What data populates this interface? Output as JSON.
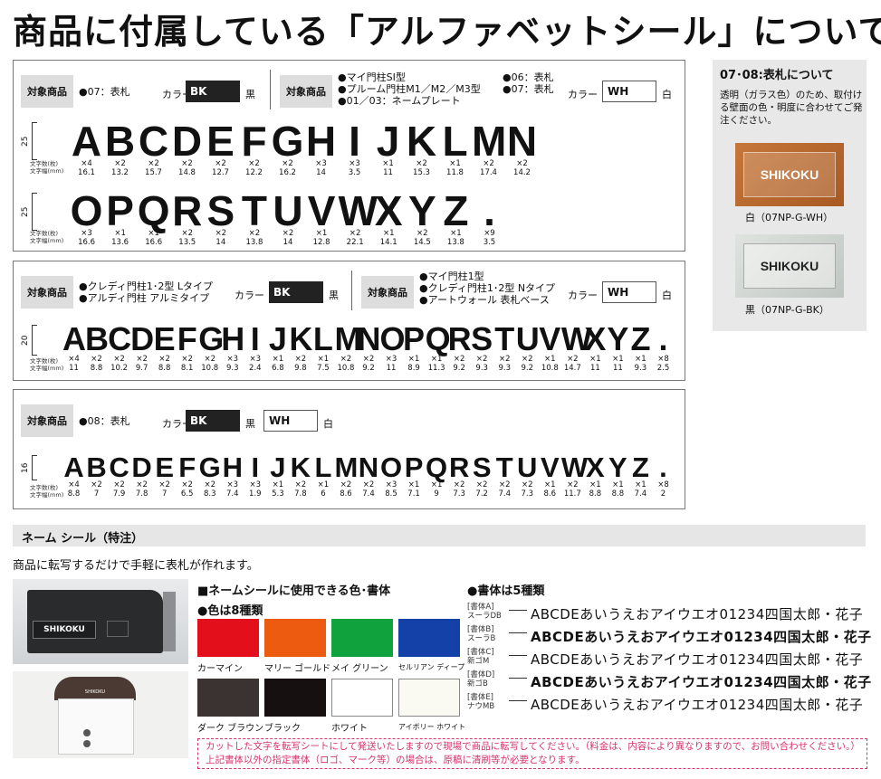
{
  "title": "商品に付属している「アルファベットシール」について",
  "common": {
    "tag": "対象商品",
    "color_label": "カラー",
    "bk": "BK",
    "wh": "WH",
    "bk_name": "黒",
    "wh_name": "白",
    "count_label": "文字数(枚)",
    "width_label": "文字幅(mm)"
  },
  "panel1": {
    "left_products": [
      "●07：表札"
    ],
    "right_products_col1": [
      "●マイ門柱SI型",
      "●プルーム門柱M1／M2／M3型",
      "●01／03：ネームプレート"
    ],
    "right_products_col2": [
      "●06：表札",
      "●07：表札"
    ],
    "height": "25",
    "row1": {
      "chars": [
        "A",
        "B",
        "C",
        "D",
        "E",
        "F",
        "G",
        "H",
        "I",
        "J",
        "K",
        "L",
        "M",
        "N"
      ],
      "counts": [
        "×4",
        "×2",
        "×2",
        "×2",
        "×2",
        "×2",
        "×2",
        "×3",
        "×3",
        "×1",
        "×2",
        "×1",
        "×2",
        "×2"
      ],
      "widths": [
        "16.1",
        "13.2",
        "15.7",
        "14.8",
        "12.7",
        "12.2",
        "16.2",
        "14",
        "3.5",
        "11",
        "15.3",
        "11.8",
        "17.4",
        "14.2"
      ]
    },
    "row2": {
      "chars": [
        "O",
        "P",
        "Q",
        "R",
        "S",
        "T",
        "U",
        "V",
        "W",
        "X",
        "Y",
        "Z",
        "."
      ],
      "counts": [
        "×3",
        "×1",
        "×1",
        "×2",
        "×2",
        "×2",
        "×2",
        "×1",
        "×2",
        "×1",
        "×2",
        "×1",
        "×9"
      ],
      "widths": [
        "16.6",
        "13.6",
        "16.6",
        "13.5",
        "14",
        "13.8",
        "14",
        "12.8",
        "22.1",
        "14.1",
        "14.5",
        "13.8",
        "3.5"
      ]
    }
  },
  "panel2": {
    "left_products": [
      "●クレディ門柱1･2型 Lタイプ",
      "●アルディ門柱 アルミタイプ"
    ],
    "right_products": [
      "●マイ門柱1型",
      "●クレディ門柱1･2型 Nタイプ",
      "●アートウォール 表札ベース"
    ],
    "height": "20",
    "row": {
      "chars": [
        "A",
        "B",
        "C",
        "D",
        "E",
        "F",
        "G",
        "H",
        "I",
        "J",
        "K",
        "L",
        "M",
        "N",
        "O",
        "P",
        "Q",
        "R",
        "S",
        "T",
        "U",
        "V",
        "W",
        "X",
        "Y",
        "Z",
        "."
      ],
      "counts": [
        "×4",
        "×2",
        "×2",
        "×2",
        "×2",
        "×2",
        "×2",
        "×3",
        "×3",
        "×1",
        "×2",
        "×1",
        "×2",
        "×2",
        "×3",
        "×1",
        "×1",
        "×2",
        "×2",
        "×2",
        "×2",
        "×1",
        "×2",
        "×1",
        "×1",
        "×1",
        "×8"
      ],
      "widths": [
        "11",
        "8.8",
        "10.2",
        "9.7",
        "8.8",
        "8.1",
        "10.8",
        "9.3",
        "2.4",
        "6.8",
        "9.8",
        "7.5",
        "10.8",
        "9.2",
        "11",
        "8.9",
        "11.3",
        "9.2",
        "9.3",
        "9.3",
        "9.2",
        "10.8",
        "14.7",
        "11",
        "11",
        "9.3",
        "2.5"
      ]
    }
  },
  "panel3": {
    "products": [
      "●08：表札"
    ],
    "height": "16",
    "row": {
      "chars": [
        "A",
        "B",
        "C",
        "D",
        "E",
        "F",
        "G",
        "H",
        "I",
        "J",
        "K",
        "L",
        "M",
        "N",
        "O",
        "P",
        "Q",
        "R",
        "S",
        "T",
        "U",
        "V",
        "W",
        "X",
        "Y",
        "Z",
        "."
      ],
      "counts": [
        "×4",
        "×2",
        "×2",
        "×2",
        "×2",
        "×2",
        "×2",
        "×3",
        "×3",
        "×1",
        "×2",
        "×1",
        "×2",
        "×2",
        "×3",
        "×1",
        "×1",
        "×2",
        "×2",
        "×2",
        "×2",
        "×1",
        "×2",
        "×1",
        "×1",
        "×1",
        "×8"
      ],
      "widths": [
        "8.8",
        "7",
        "7.9",
        "7.8",
        "7",
        "6.5",
        "8.3",
        "7.4",
        "1.9",
        "5.3",
        "7.8",
        "6",
        "8.6",
        "7.4",
        "8.5",
        "7.1",
        "9",
        "7.3",
        "7.2",
        "7.4",
        "7.3",
        "8.6",
        "11.7",
        "8.8",
        "8.8",
        "7.4",
        "2"
      ]
    }
  },
  "side": {
    "heading": "07･08:表札について",
    "text": "透明（ガラス色）のため、取付ける壁面の色・明度に合わせてご発注ください。",
    "plate1": {
      "text": "SHIKOKU",
      "caption": "白（07NP-G-WH）"
    },
    "plate2": {
      "text": "SHIKOKU",
      "caption": "黒（07NP-G-BK）"
    }
  },
  "name_seal": {
    "bar": "ネーム シール（特注）",
    "intro": "商品に転写するだけで手軽に表札が作れます。",
    "mailbox_label": "SHIKOKU",
    "mailbox2_label": "SHIKOKU",
    "colors_heading": "■ネームシールに使用できる色･書体",
    "colors_sub": "●色は8種類",
    "colors": [
      {
        "name": "カーマイン",
        "hex": "#e3101c"
      },
      {
        "name": "マリー ゴールド",
        "hex": "#ec5b0f"
      },
      {
        "name": "メイ グリーン",
        "hex": "#10a23c"
      },
      {
        "name": "セルリアン ディープ",
        "hex": "#1441a8"
      },
      {
        "name": "ダーク ブラウン",
        "hex": "#3a3331"
      },
      {
        "name": "ブラック",
        "hex": "#161010"
      },
      {
        "name": "ホワイト",
        "hex": "#ffffff"
      },
      {
        "name": "アイボリー ホワイト",
        "hex": "#fbfaf2"
      }
    ],
    "fonts_heading": "●書体は5種類",
    "fonts": [
      {
        "label": "[書体A]",
        "sub": "スーラDB",
        "sample": "ABCDEあいうえおアイウエオ01234四国太郎・花子"
      },
      {
        "label": "[書体B]",
        "sub": "スーラB",
        "sample": "ABCDEあいうえおアイウエオ01234四国太郎・花子"
      },
      {
        "label": "[書体C]",
        "sub": "新ゴM",
        "sample": "ABCDEあいうえおアイウエオ01234四国太郎・花子"
      },
      {
        "label": "[書体D]",
        "sub": "新ゴB",
        "sample": "ABCDEあいうえおアイウエオ01234四国太郎・花子"
      },
      {
        "label": "[書体E]",
        "sub": "ナウMB",
        "sample": "ABCDEあいうえおアイウエオ01234四国太郎・花子"
      }
    ],
    "note_line1": "カットした文字を転写シートにして発送いたしますので現場で商品に転写してください。（料金は、内容により異なりますので、お問い合わせください。）",
    "note_line2": "上記書体以外の指定書体（ロゴ、マーク等）の場合は、原稿に清刷等が必要となります。"
  }
}
